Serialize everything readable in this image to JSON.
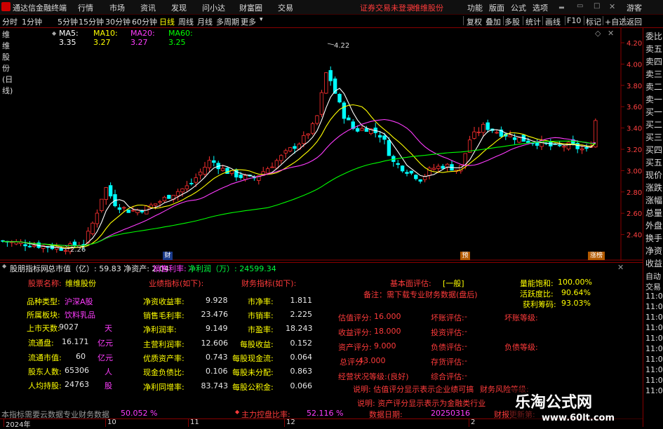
{
  "titlebar": {
    "app_title": "通达信金融终端",
    "menus": [
      "行情",
      "市场",
      "资讯",
      "发现",
      "问小达",
      "财富圈",
      "交易"
    ],
    "notice": "证券交易未登录",
    "stock": "维维股份",
    "right_menus": [
      "功能",
      "版面",
      "公式",
      "选项"
    ],
    "guest": "游客"
  },
  "periodbar": {
    "periods": [
      "分时",
      "1分钟",
      "5分钟",
      "15分钟",
      "30分钟",
      "60分钟",
      "日线",
      "周线",
      "月线",
      "多周期",
      "更多"
    ],
    "active": "日线",
    "tools": [
      "复权",
      "叠加",
      "多股",
      "统计",
      "画线",
      "F10",
      "标记",
      "+自选",
      "返回"
    ]
  },
  "chart": {
    "name": "维维股份(日线)",
    "ma": [
      {
        "label": "MA5: 3.35",
        "color": "#ffffff"
      },
      {
        "label": "MA10: 3.27",
        "color": "#ffff00"
      },
      {
        "label": "MA20: 3.27",
        "color": "#ff3cff"
      },
      {
        "label": "MA60: 3.25",
        "color": "#00ff00"
      }
    ],
    "y_ticks": [
      "4.20",
      "4.00",
      "3.80",
      "3.60",
      "3.40",
      "3.20",
      "3.00",
      "2.80",
      "2.60",
      "2.40"
    ],
    "high_label": "4.22",
    "low_label": "2.26",
    "markers": [
      "财",
      "预",
      "涨榜"
    ],
    "x_ticks": [
      "2024年",
      "10",
      "11",
      "12",
      "2"
    ]
  },
  "rail": [
    "委比",
    "卖五",
    "卖四",
    "卖三",
    "卖二",
    "卖一",
    "买一",
    "买二",
    "买三",
    "买四",
    "买五",
    "现价",
    "涨跌",
    "涨幅",
    "总量",
    "外盘",
    "换手",
    "净资",
    "收益",
    "自动",
    "交易",
    "11:08",
    "11:08",
    "11:08",
    "11:08",
    "11:08",
    "11:08",
    "11:08",
    "11:08",
    "11:08",
    "11:08"
  ],
  "panel": {
    "title": "股朋指标网",
    "summary": "总市值（亿）: 59.83 净资产: 2.04",
    "margin_label": "销售利率: -",
    "profit_label": "净利润（万）: 24599.34",
    "stock_name_label": "股票名称:",
    "stock_name": "维维股份",
    "col1": [
      {
        "label": "品种类型:",
        "value": "沪深A股"
      },
      {
        "label": "所属板块:",
        "value": "饮料乳品"
      },
      {
        "label": "上市天数:",
        "value": "9027",
        "unit": "天"
      },
      {
        "label": "流通盘:",
        "value": "16.171",
        "unit": "亿元"
      },
      {
        "label": "流通市值:",
        "value": "60",
        "unit": "亿元"
      },
      {
        "label": "股东人数:",
        "value": "65306",
        "unit": "人"
      },
      {
        "label": "人均持股:",
        "value": "24763",
        "unit": "股"
      }
    ],
    "col2_header": "业绩指标(如下):",
    "col2": [
      {
        "label": "净资收益率:",
        "value": "9.928"
      },
      {
        "label": "销售毛利率:",
        "value": "23.476"
      },
      {
        "label": "净利润率:",
        "value": "9.149"
      },
      {
        "label": "主营利润率:",
        "value": "12.606"
      },
      {
        "label": "优质资产率:",
        "value": "0.743"
      },
      {
        "label": "现金负债比:",
        "value": "0.106"
      },
      {
        "label": "净利同增率:",
        "value": "83.743"
      }
    ],
    "col3_header": "财务指标(如下):",
    "col3": [
      {
        "label": "市净率:",
        "value": "1.811"
      },
      {
        "label": "市销率:",
        "value": "2.225"
      },
      {
        "label": "市盈率:",
        "value": "18.243"
      },
      {
        "label": "每股收益:",
        "value": "0.152"
      },
      {
        "label": "每股现金流:",
        "value": "0.064"
      },
      {
        "label": "每股未分配:",
        "value": "0.863"
      },
      {
        "label": "每股公积金:",
        "value": "0.066"
      }
    ],
    "fund_label": "基本面评估:",
    "fund_value": "[一般]",
    "note": "备注：需下载专业财务数据(盘后)",
    "liang_label": "量能饱和:",
    "liang_value": "100.00%",
    "huo_label": "活跃度比:",
    "huo_value": "90.64%",
    "huoli_label": "获利筹码:",
    "huoli_value": "93.03%",
    "scores": [
      {
        "label": "估值评分:",
        "value": "16.000"
      },
      {
        "label": "收益评分:",
        "value": "18.000"
      },
      {
        "label": "资产评分:",
        "value": "9.000"
      },
      {
        "label": "总评分:",
        "value": "43.000"
      }
    ],
    "jingying_label": "经营状况等级:",
    "jingying_value": "(良好)",
    "evals": [
      {
        "label": "坏账评估:",
        "value": "-"
      },
      {
        "label": "投资评估:",
        "value": "-"
      },
      {
        "label": "负债评估:",
        "value": "-"
      },
      {
        "label": "存货评估:",
        "value": "-"
      },
      {
        "label": "综合评估:",
        "value": "-"
      }
    ],
    "huaizhang_level": "坏账等级:",
    "fuzhai_level": "负债等级:",
    "explain1": "说明: 估值评分显示表示企业绩可搞",
    "explain2": "说明: 资产评分显示表示为金融类行业",
    "risk_label": "财务风险等级:",
    "footer_left": "本指标需要云数据专业财务数据",
    "footer_pct1": "50.052 %",
    "zhuli_label": "主力控盘比率:",
    "zhuli_value": "52.116 %",
    "date_label": "数据日期:",
    "date_value": "20250316",
    "update_label": "财报更新第:"
  },
  "watermark": {
    "line1": "乐淘公式网",
    "line2": "www.60lt.com"
  }
}
